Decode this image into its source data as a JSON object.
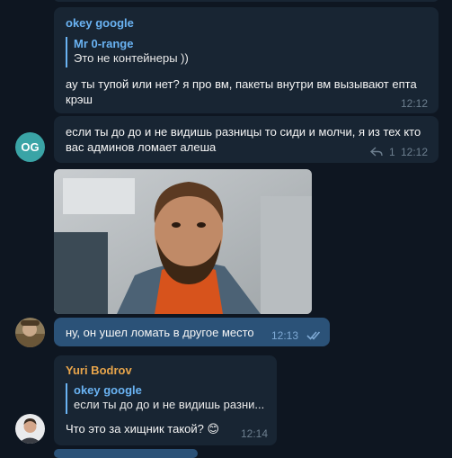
{
  "messages": {
    "m1": {
      "sender": "okey google",
      "sender_color": "#6ab3f3",
      "reply_name": "Mr 0-range",
      "reply_text": "Это не контейнеры ))",
      "text": "ау ты тупой или нет? я про вм, пакеты внутри вм вызывают епта крэш",
      "time": "12:12"
    },
    "m2": {
      "text": "если ты до до и не видишь разницы то сиди и молчи, я из тех кто вас админов ломает алеша",
      "reply_count": "1",
      "time": "12:12",
      "avatar_initials": "OG",
      "avatar_color": "#3aa4a6"
    },
    "m3": {
      "text": "ну, он ушел ломать в другое место",
      "time": "12:13",
      "status": "read-double-check-icon"
    },
    "m4": {
      "sender": "Yuri Bodrov",
      "sender_color": "#e8a54b",
      "reply_name": "okey google",
      "reply_text": "если ты до до и не видишь разни...",
      "text": "Что это за хищник такой? 😊",
      "time": "12:14"
    }
  }
}
